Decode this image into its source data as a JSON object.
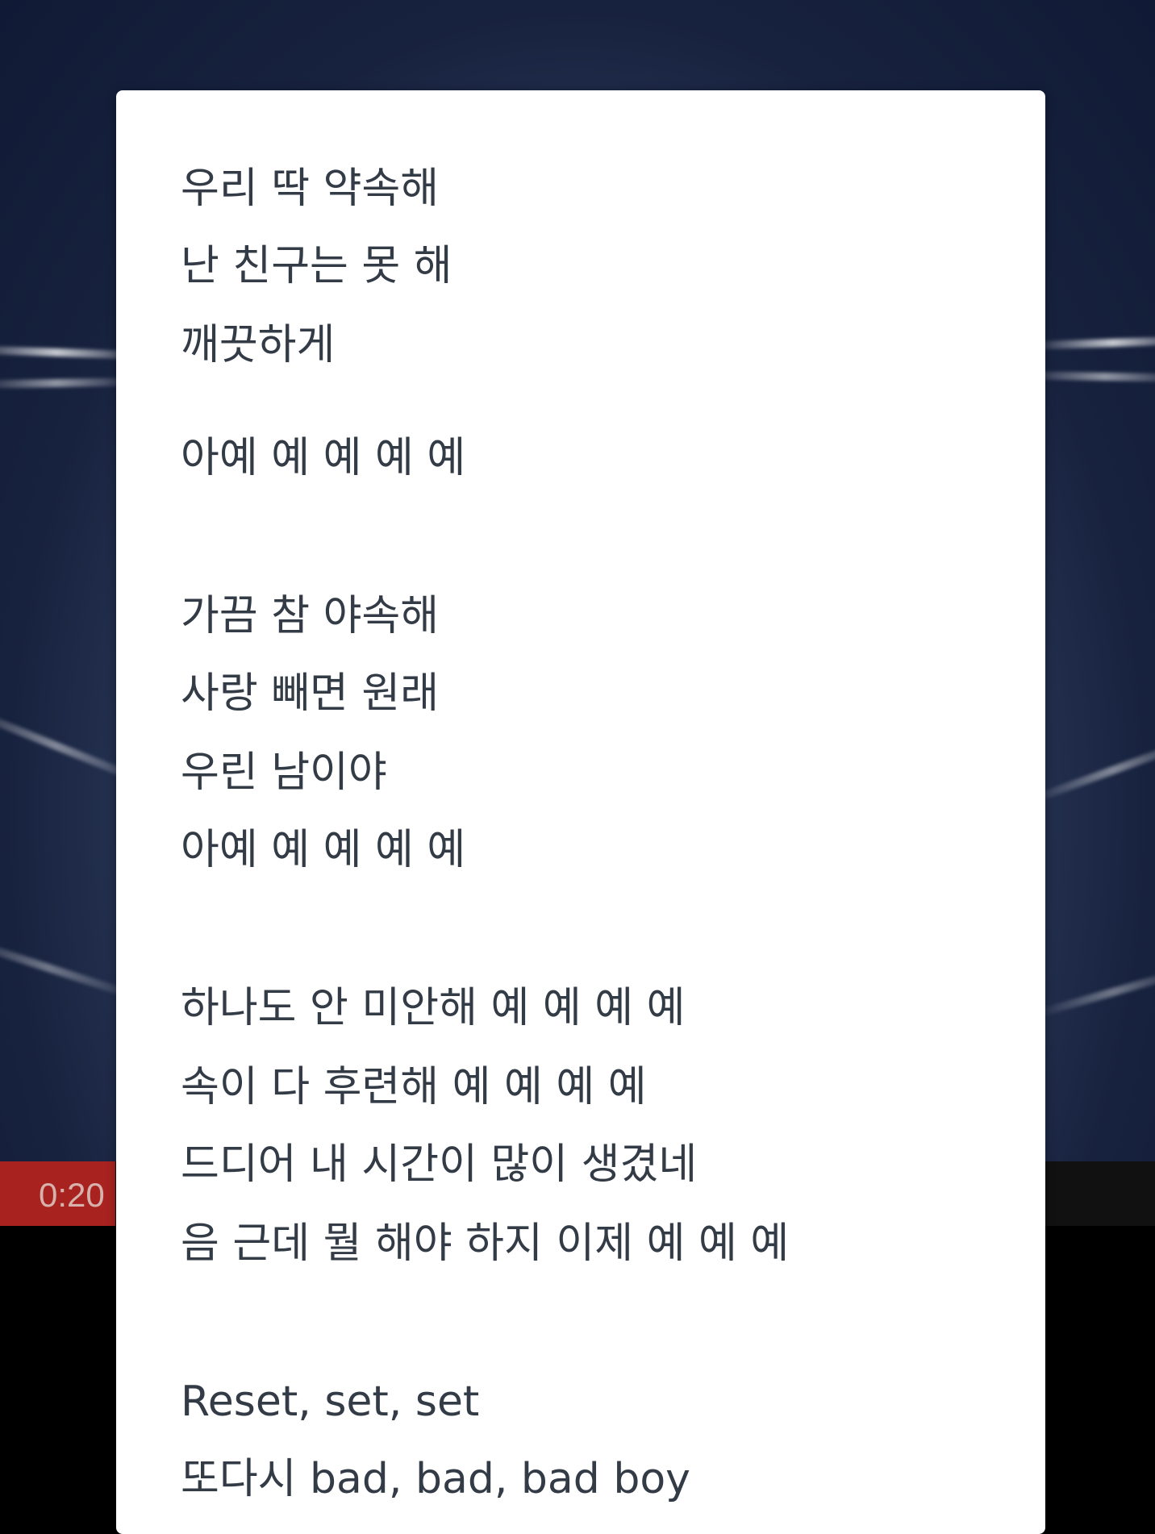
{
  "player": {
    "current_time": "0:20",
    "progress": 0.1,
    "accent_color": "#a8231f"
  },
  "lyrics": {
    "lines": [
      "우리 딱 약속해",
      "난 친구는 못 해",
      "깨끗하게",
      "아예 예 예 예 예",
      "가끔 참 야속해",
      "사랑 빼면 원래",
      "우린 남이야",
      "아예 예 예 예 예",
      "하나도 안 미안해 예 예 예 예",
      "속이 다 후련해 예 예 예 예",
      "드디어 내 시간이 많이 생겼네",
      "음 근데 뭘 해야 하지 이제 예 예 예",
      "Reset, set, set",
      "또다시 bad, bad, bad boy"
    ]
  }
}
